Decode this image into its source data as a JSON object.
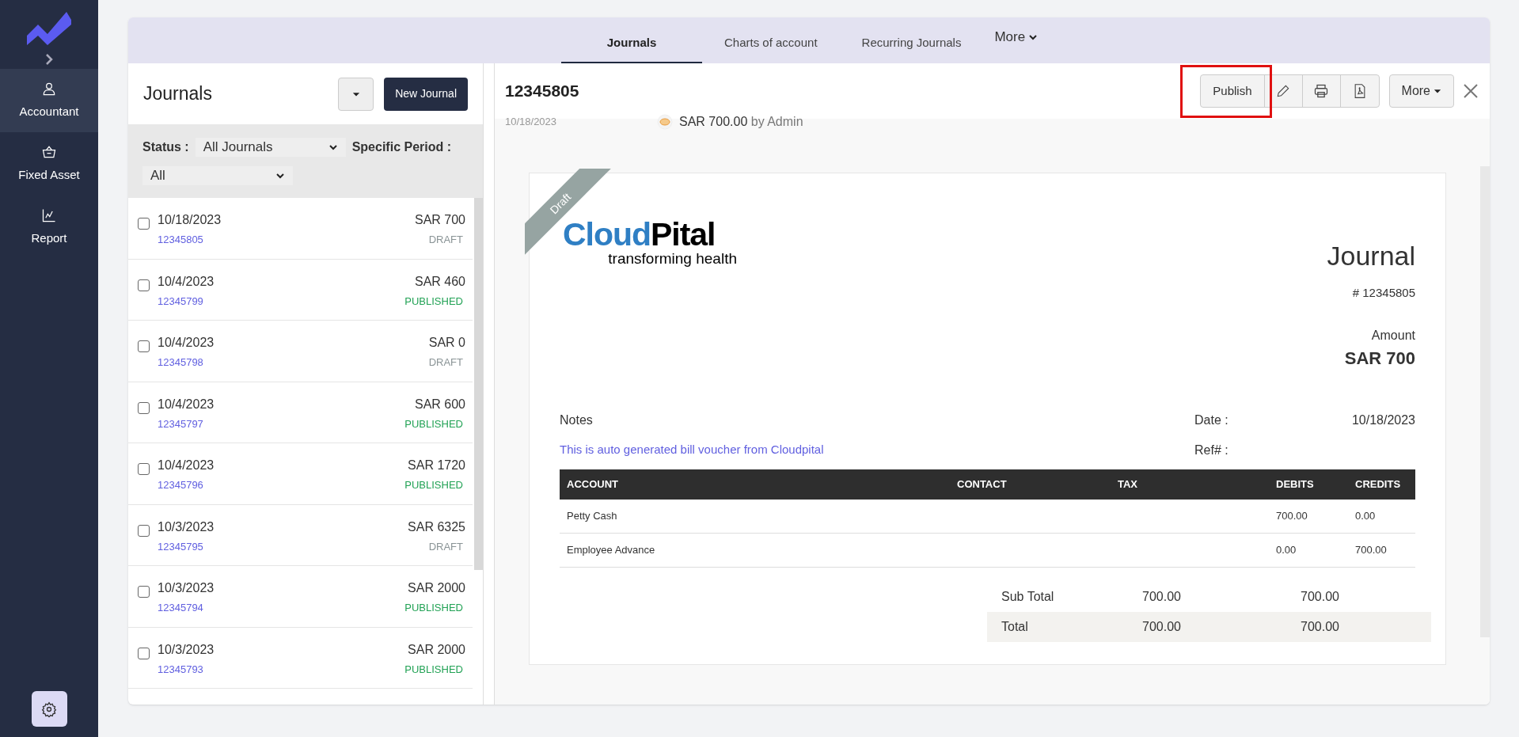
{
  "sidebar": {
    "items": [
      {
        "kind": "user",
        "label": "Accountant",
        "selected": true
      },
      {
        "kind": "basket",
        "label": "Fixed Asset",
        "selected": false
      },
      {
        "kind": "chart",
        "label": "Report",
        "selected": false
      }
    ]
  },
  "tabs": [
    {
      "label": "Journals",
      "selected": true
    },
    {
      "label": "Charts of account",
      "selected": false
    },
    {
      "label": "Recurring Journals",
      "selected": false
    }
  ],
  "tabs_more": "More",
  "list": {
    "title": "Journals",
    "new_button": "New Journal",
    "status_label": "Status :",
    "status_value": "All Journals",
    "period_label": "Specific Period :",
    "period_value": "All",
    "rows": [
      {
        "date": "10/18/2023",
        "number": "12345805",
        "amount": "SAR 700",
        "status": "DRAFT",
        "published": false,
        "checked": false
      },
      {
        "date": "10/4/2023",
        "number": "12345799",
        "amount": "SAR 460",
        "status": "PUBLISHED",
        "published": true,
        "checked": false
      },
      {
        "date": "10/4/2023",
        "number": "12345798",
        "amount": "SAR 0",
        "status": "DRAFT",
        "published": false,
        "checked": false
      },
      {
        "date": "10/4/2023",
        "number": "12345797",
        "amount": "SAR 600",
        "status": "PUBLISHED",
        "published": true,
        "checked": false
      },
      {
        "date": "10/4/2023",
        "number": "12345796",
        "amount": "SAR 1720",
        "status": "PUBLISHED",
        "published": true,
        "checked": false
      },
      {
        "date": "10/3/2023",
        "number": "12345795",
        "amount": "SAR 6325",
        "status": "DRAFT",
        "published": false,
        "checked": false
      },
      {
        "date": "10/3/2023",
        "number": "12345794",
        "amount": "SAR 2000",
        "status": "PUBLISHED",
        "published": true,
        "checked": false
      },
      {
        "date": "10/3/2023",
        "number": "12345793",
        "amount": "SAR 2000",
        "status": "PUBLISHED",
        "published": true,
        "checked": false
      }
    ]
  },
  "detail": {
    "title": "12345805",
    "publish_button": "Publish",
    "publish_highlighted": true,
    "more_button": "More",
    "activity": {
      "date": "10/18/2023",
      "amount": "SAR 700.00",
      "by": "by Admin"
    },
    "document": {
      "ribbon": "Draft",
      "logo_start": "Cloud",
      "logo_end": "Pital",
      "tagline": "transforming health",
      "heading": "Journal",
      "number": "# 12345805",
      "amount_label": "Amount",
      "amount": "SAR 700",
      "notes_label": "Notes",
      "notes": "This is auto generated bill voucher from Cloudpital",
      "date_label": "Date :",
      "date": "10/18/2023",
      "ref_label": "Ref# :",
      "table": {
        "columns": [
          "ACCOUNT",
          "CONTACT",
          "TAX",
          "DEBITS",
          "CREDITS"
        ],
        "rows": [
          [
            "Petty Cash",
            "",
            "",
            "700.00",
            "0.00"
          ],
          [
            "Employee Advance",
            "",
            "",
            "0.00",
            "700.00"
          ]
        ]
      },
      "totals": [
        {
          "label": "Sub Total",
          "debit": "700.00",
          "credit": "700.00"
        },
        {
          "label": "Total",
          "debit": "700.00",
          "credit": "700.00"
        }
      ]
    }
  }
}
